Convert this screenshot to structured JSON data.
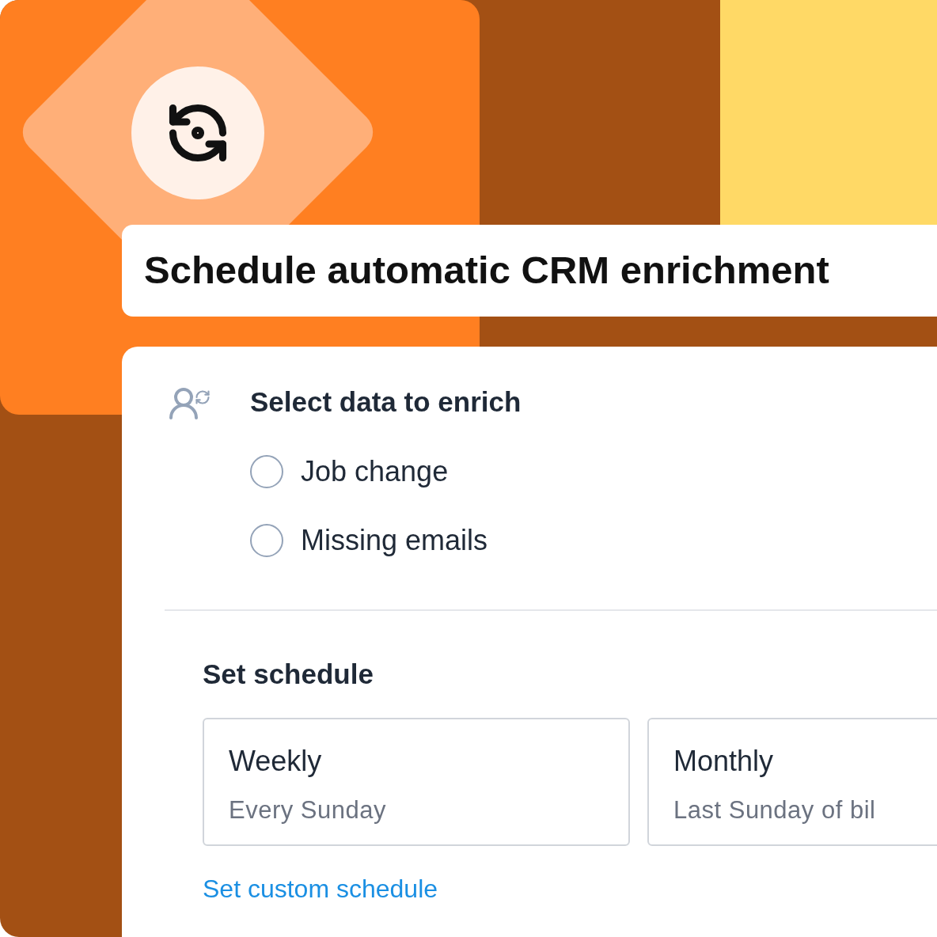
{
  "title": "Schedule automatic CRM enrichment",
  "data_section": {
    "heading": "Select data to enrich",
    "options": [
      {
        "label": "Job change",
        "selected": false
      },
      {
        "label": "Missing emails",
        "selected": false
      }
    ]
  },
  "schedule_section": {
    "heading": "Set schedule",
    "options": [
      {
        "title": "Weekly",
        "description": "Every Sunday",
        "selected": false
      },
      {
        "title": "Monthly",
        "description": "Last Sunday of bil",
        "selected": false
      }
    ],
    "link": "Set custom schedule"
  }
}
